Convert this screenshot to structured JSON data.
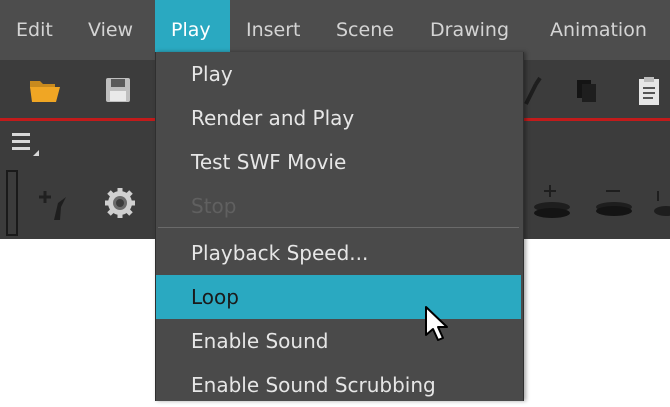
{
  "menubar": {
    "items": [
      {
        "label": "Edit"
      },
      {
        "label": "View"
      },
      {
        "label": "Play"
      },
      {
        "label": "Insert"
      },
      {
        "label": "Scene"
      },
      {
        "label": "Drawing"
      },
      {
        "label": "Animation"
      }
    ],
    "active": "Play"
  },
  "toolbar": {
    "icons": [
      "open-folder-icon",
      "save-icon",
      "layers-icon",
      "clipboard-icon",
      "hamburger-menu-icon",
      "add-bone-icon",
      "gear-icon",
      "add-layer-icon",
      "remove-layer-icon"
    ]
  },
  "play_menu": {
    "items": [
      {
        "label": "Play",
        "enabled": true
      },
      {
        "label": "Render and Play",
        "enabled": true
      },
      {
        "label": "Test SWF Movie",
        "enabled": true
      },
      {
        "label": "Stop",
        "enabled": false
      },
      {
        "label": "Playback Speed...",
        "enabled": true
      },
      {
        "label": "Loop",
        "enabled": true,
        "highlighted": true
      },
      {
        "label": "Enable Sound",
        "enabled": true
      },
      {
        "label": "Enable Sound Scrubbing",
        "enabled": true
      }
    ]
  },
  "colors": {
    "menubar_bg": "#4d4d4d",
    "toolbar_bg": "#3c3c3c",
    "accent": "#2aa9c1",
    "timeline_marker": "#c21b1b",
    "menu_bg": "#4a4a4a"
  }
}
